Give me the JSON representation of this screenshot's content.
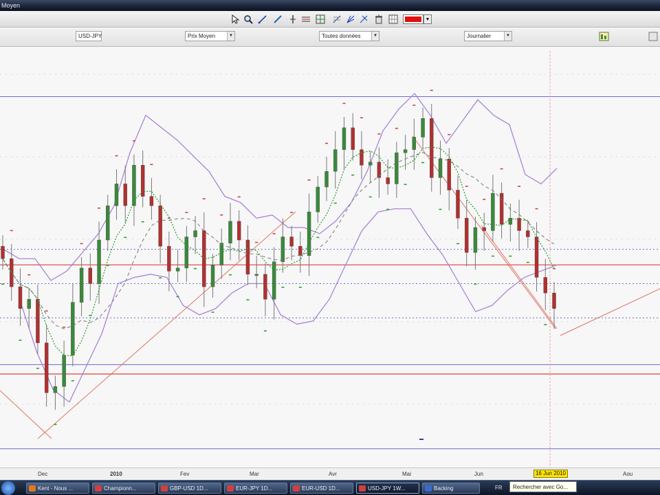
{
  "window": {
    "title": "Moyen"
  },
  "colors": {
    "selected_color": "#e01010",
    "accent": "#2b3b57"
  },
  "toolbar": {
    "tools": [
      {
        "name": "pointer-icon"
      },
      {
        "name": "zoom-icon"
      },
      {
        "name": "line-icon"
      },
      {
        "name": "pen-icon"
      },
      {
        "name": "vertical-line-icon"
      },
      {
        "name": "horizontal-lines-icon"
      },
      {
        "name": "crosshair-icon"
      },
      {
        "name": "fibonacci-icon"
      },
      {
        "name": "trend-fan-icon"
      },
      {
        "name": "eraser-icon"
      },
      {
        "name": "trash-icon"
      }
    ]
  },
  "selectors": {
    "symbol": "USD-JPY",
    "price_type": "Prix Moyen",
    "data_range": "Toutes données",
    "period": "Journalier"
  },
  "chart_data": {
    "type": "candlestick",
    "x_tick_labels": [
      "Dec",
      "2010",
      "Fev",
      "Mar",
      "Avr",
      "Mai",
      "Jun",
      "Aou"
    ],
    "highlighted_date": "16 Jun 2010",
    "series": [
      {
        "name": "price",
        "values": [
          90.2,
          89.3,
          88.6,
          88.9,
          87.5,
          85.9,
          86.1,
          87.1,
          88.8,
          89.9,
          89.4,
          90.8,
          91.9,
          92.6,
          91.9,
          93.2,
          92.2,
          91.9,
          90.6,
          89.8,
          89.9,
          90.9,
          91.1,
          89.3,
          90.0,
          90.7,
          91.4,
          90.8,
          89.7,
          89.7,
          88.9,
          90.1,
          90.9,
          90.6,
          90.3,
          91.7,
          92.5,
          93.0,
          93.7,
          94.4,
          93.7,
          93.2,
          93.3,
          92.8,
          92.6,
          93.6,
          93.7,
          94.1,
          94.7,
          92.8,
          93.4,
          92.4,
          91.5,
          90.4,
          91.2,
          91.1,
          92.3,
          91.3,
          91.5,
          91.1,
          90.9,
          89.6,
          89.1,
          88.6
        ]
      }
    ],
    "bollinger": {
      "upper": [
        90.5,
        90.2,
        90.2,
        89.5,
        89.8,
        90.4,
        91.0,
        91.9,
        93.6,
        94.8,
        94.4,
        94.0,
        93.5,
        93.0,
        92.2,
        92.0,
        91.5,
        91.6,
        91.2,
        91.2,
        91.0,
        91.4,
        92.0,
        93.0,
        94.3,
        95.0,
        95.5,
        94.8,
        93.9,
        94.6,
        95.3,
        94.8,
        94.5,
        92.9,
        92.6,
        93.1
      ],
      "lower": [
        88.8,
        87.2,
        86.0,
        85.6,
        86.7,
        87.8,
        89.4,
        89.6,
        89.7,
        89.6,
        88.7,
        88.4,
        88.6,
        89.1,
        89.4,
        89.4,
        88.4,
        88.1,
        88.2,
        88.9,
        90.0,
        91.1,
        91.7,
        91.8,
        91.8,
        91.0,
        90.3,
        89.4,
        88.5,
        88.7,
        89.2,
        89.6,
        89.8,
        90.0
      ]
    },
    "horizontal_levels": {
      "blue": [
        95.4,
        90.5,
        89.4,
        88.3,
        86.8,
        84.1
      ],
      "red": [
        90.0,
        86.5
      ]
    },
    "grid": true
  },
  "taskbar": {
    "items": [
      {
        "label": "Kent - Nous ...",
        "color": "#e07a1a"
      },
      {
        "label": "Championn...",
        "color": "#d04040"
      },
      {
        "label": "GBP-USD 1D...",
        "color": "#d04040"
      },
      {
        "label": "EUR-JPY 1D...",
        "color": "#d04040"
      },
      {
        "label": "EUR-USD 1D...",
        "color": "#d04040"
      },
      {
        "label": "USD-JPY 1W...",
        "color": "#d04040"
      },
      {
        "label": "Backing",
        "color": "#3a6ad0"
      }
    ],
    "language": "FR",
    "search_tooltip": "Rechercher avec Go..."
  }
}
